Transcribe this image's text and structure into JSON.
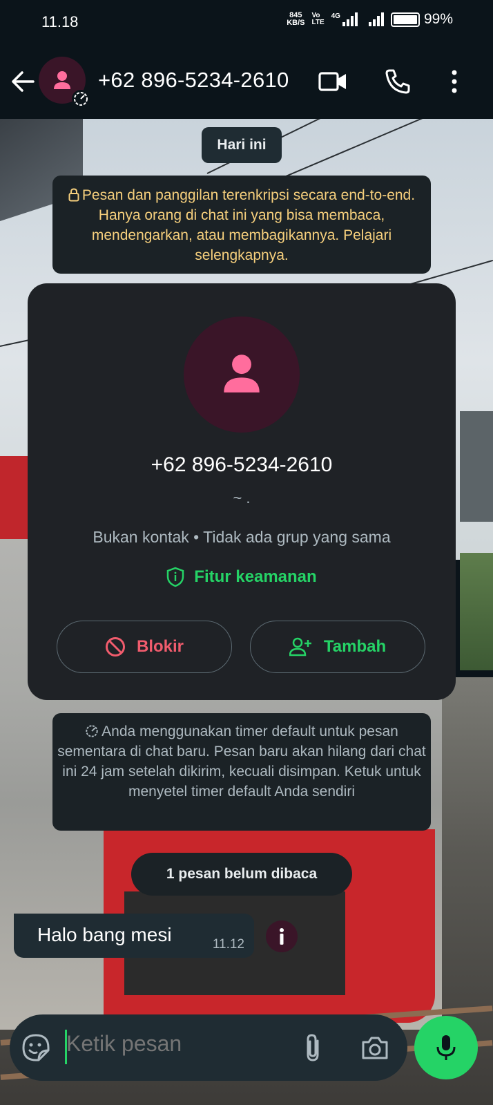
{
  "status_bar": {
    "time": "11.18",
    "net_speed_value": "845",
    "net_speed_unit": "KB/S",
    "volte_top": "Vo",
    "volte_bottom": "LTE",
    "network": "4G",
    "battery": "99%",
    "battery_level": 0.99
  },
  "header": {
    "title": "+62 896-5234-2610",
    "icons": [
      "back-arrow-icon",
      "avatar-icon",
      "disappearing-timer-icon",
      "video-call-icon",
      "voice-call-icon",
      "more-options-icon"
    ]
  },
  "chat": {
    "date_chip": "Hari ini",
    "encryption_notice": "Pesan dan panggilan terenkripsi secara end-to-end. Hanya orang di chat ini yang bisa membaca, mendengarkan, atau membagikannya. Pelajari selengkapnya.",
    "contact_card": {
      "phone": "+62 896-5234-2610",
      "about": "~ .",
      "meta": "Bukan kontak • Tidak ada grup yang sama",
      "security_label": "Fitur keamanan",
      "block_label": "Blokir",
      "add_label": "Tambah"
    },
    "timer_notice": "Anda menggunakan timer default untuk pesan sementara di chat baru. Pesan baru akan hilang dari chat ini 24 jam setelah dikirim, kecuali disimpan. Ketuk untuk menyetel timer default Anda sendiri",
    "unread_chip": "1 pesan belum dibaca",
    "messages": [
      {
        "text": "Halo bang mesi",
        "time": "11.12",
        "direction": "incoming"
      }
    ]
  },
  "composer": {
    "placeholder": "Ketik pesan"
  },
  "colors": {
    "accent_green": "#25d366",
    "danger_red": "#f15c6d",
    "notice_yellow": "#f7d07d",
    "avatar_pink": "#ff6d9d",
    "avatar_bg": "#3a1528"
  }
}
